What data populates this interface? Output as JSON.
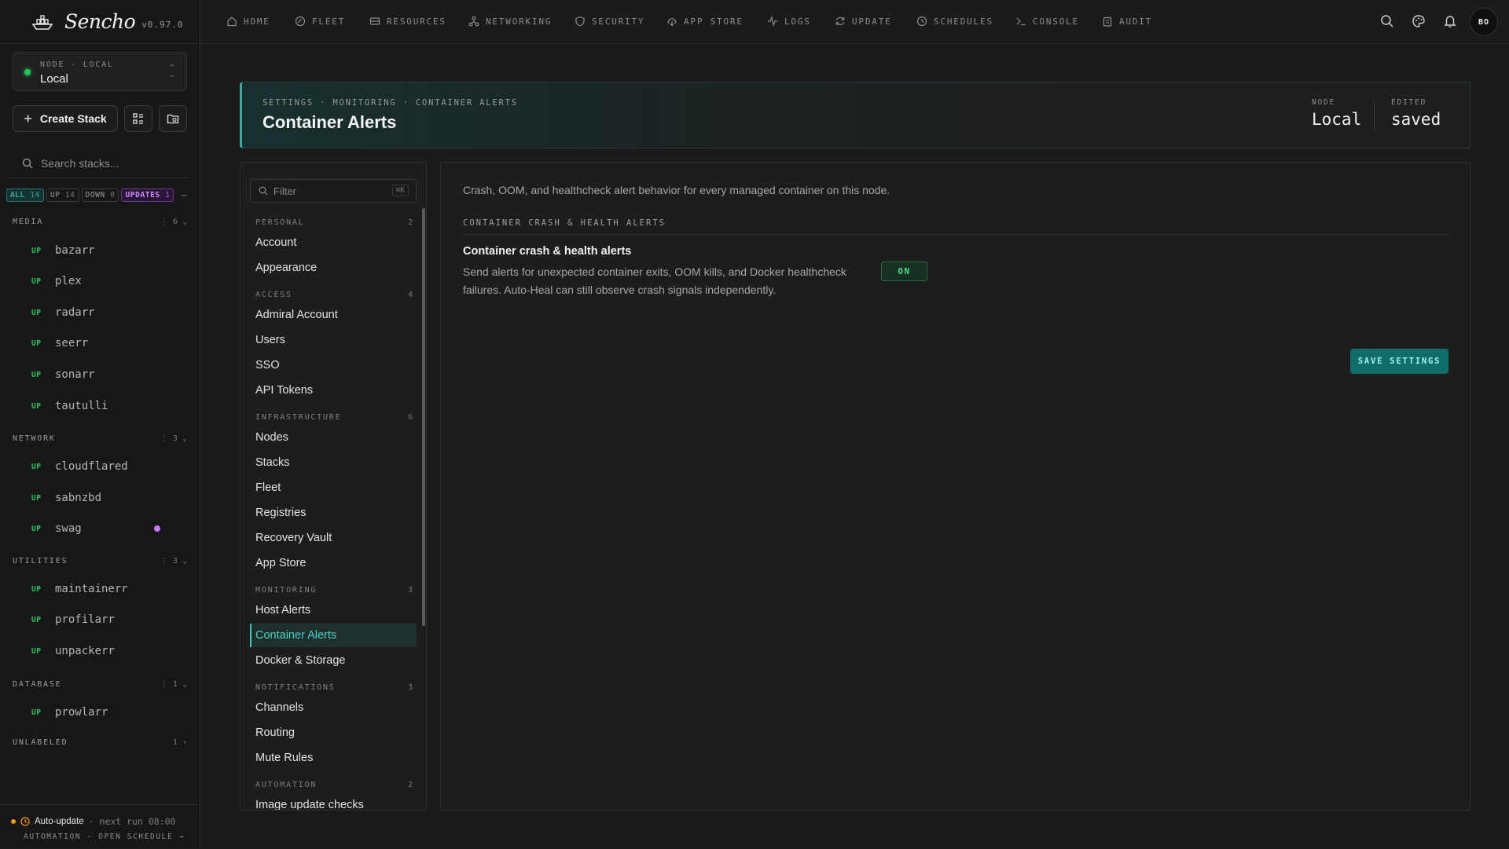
{
  "brand": {
    "name": "Sencho",
    "version": "v0.97.0"
  },
  "node_selector": {
    "label": "NODE · LOCAL",
    "value": "Local"
  },
  "actions": {
    "create_stack": "Create Stack"
  },
  "search": {
    "placeholder": "Search stacks..."
  },
  "filters": [
    {
      "label": "ALL",
      "count": "14"
    },
    {
      "label": "UP",
      "count": "14"
    },
    {
      "label": "DOWN",
      "count": "0"
    },
    {
      "label": "UPDATES",
      "count": "1"
    }
  ],
  "groups": {
    "media": {
      "label": "MEDIA",
      "count": "6",
      "items": [
        {
          "status": "UP",
          "name": "bazarr"
        },
        {
          "status": "UP",
          "name": "plex"
        },
        {
          "status": "UP",
          "name": "radarr"
        },
        {
          "status": "UP",
          "name": "seerr"
        },
        {
          "status": "UP",
          "name": "sonarr"
        },
        {
          "status": "UP",
          "name": "tautulli"
        }
      ]
    },
    "network": {
      "label": "NETWORK",
      "count": "3",
      "items": [
        {
          "status": "UP",
          "name": "cloudflared"
        },
        {
          "status": "UP",
          "name": "sabnzbd"
        },
        {
          "status": "UP",
          "name": "swag"
        }
      ]
    },
    "utilities": {
      "label": "UTILITIES",
      "count": "3",
      "items": [
        {
          "status": "UP",
          "name": "maintainerr"
        },
        {
          "status": "UP",
          "name": "profilarr"
        },
        {
          "status": "UP",
          "name": "unpackerr"
        }
      ]
    },
    "database": {
      "label": "DATABASE",
      "count": "1",
      "items": [
        {
          "status": "UP",
          "name": "prowlarr"
        }
      ]
    },
    "unlabeled": {
      "label": "UNLABELED",
      "count": "1"
    }
  },
  "auto_update": {
    "label": "Auto-update",
    "next": "· next run 08:00",
    "sub": "AUTOMATION · OPEN SCHEDULE →"
  },
  "topnav": [
    {
      "label": "HOME",
      "icon": "home-icon"
    },
    {
      "label": "FLEET",
      "icon": "fleet-icon"
    },
    {
      "label": "RESOURCES",
      "icon": "resources-icon"
    },
    {
      "label": "NETWORKING",
      "icon": "networking-icon"
    },
    {
      "label": "SECURITY",
      "icon": "shield-icon"
    },
    {
      "label": "APP STORE",
      "icon": "cloud-download-icon"
    },
    {
      "label": "LOGS",
      "icon": "activity-icon"
    },
    {
      "label": "UPDATE",
      "icon": "refresh-icon"
    },
    {
      "label": "SCHEDULES",
      "icon": "clock-icon"
    },
    {
      "label": "CONSOLE",
      "icon": "terminal-icon"
    },
    {
      "label": "AUDIT",
      "icon": "clipboard-icon"
    }
  ],
  "user": {
    "initials": "BO"
  },
  "header": {
    "breadcrumb": "SETTINGS · MONITORING · CONTAINER ALERTS",
    "title": "Container Alerts",
    "node_label": "NODE",
    "node_value": "Local",
    "edited_label": "EDITED",
    "edited_value": "saved"
  },
  "settings_nav": {
    "filter_placeholder": "Filter",
    "filter_kbd": "⌘K",
    "sections": {
      "personal": {
        "label": "PERSONAL",
        "count": "2",
        "items": [
          "Account",
          "Appearance"
        ]
      },
      "access": {
        "label": "ACCESS",
        "count": "4",
        "items": [
          "Admiral Account",
          "Users",
          "SSO",
          "API Tokens"
        ]
      },
      "infrastructure": {
        "label": "INFRASTRUCTURE",
        "count": "6",
        "items": [
          "Nodes",
          "Stacks",
          "Fleet",
          "Registries",
          "Recovery Vault",
          "App Store"
        ]
      },
      "monitoring": {
        "label": "MONITORING",
        "count": "3",
        "items": [
          "Host Alerts",
          "Container Alerts",
          "Docker & Storage"
        ]
      },
      "notifications": {
        "label": "NOTIFICATIONS",
        "count": "3",
        "items": [
          "Channels",
          "Routing",
          "Mute Rules"
        ]
      },
      "automation": {
        "label": "AUTOMATION",
        "count": "2",
        "items": [
          "Image update checks"
        ]
      }
    }
  },
  "content": {
    "description": "Crash, OOM, and healthcheck alert behavior for every managed container on this node.",
    "section_title": "CONTAINER CRASH & HEALTH ALERTS",
    "option_title": "Container crash & health alerts",
    "option_desc": "Send alerts for unexpected container exits, OOM kills, and Docker healthcheck failures. Auto-Heal can still observe crash signals independently.",
    "toggle": "ON",
    "save": "SAVE SETTINGS"
  },
  "colors": {
    "accent": "#3cc4b8",
    "status_up": "#22c55e",
    "update": "#c77dff"
  }
}
